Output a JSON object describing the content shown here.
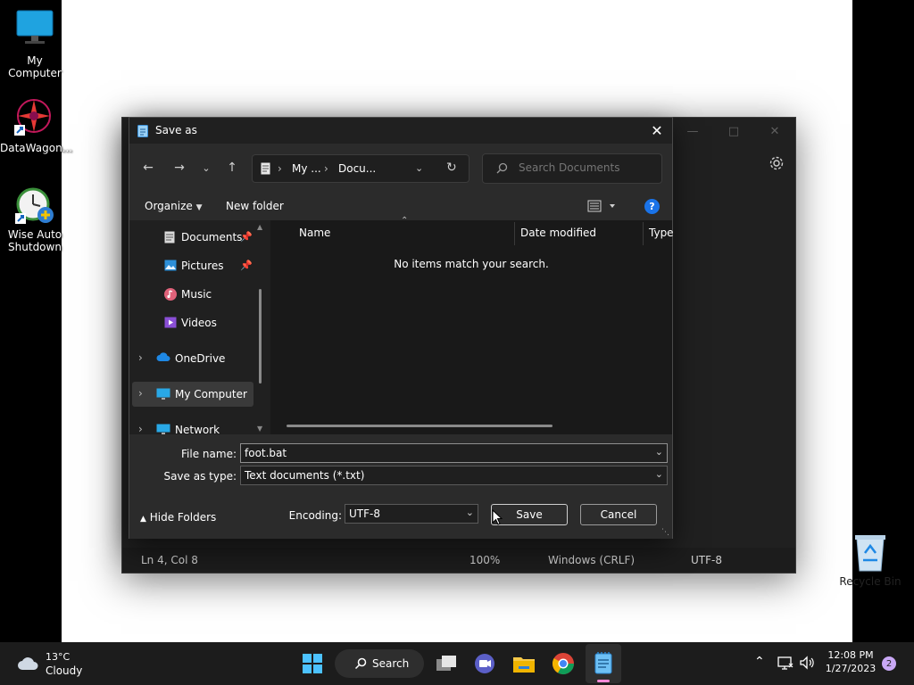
{
  "desktop": {
    "icons": [
      {
        "label": "My Computer"
      },
      {
        "label": "DataWagon..."
      },
      {
        "label": "Wise Auto Shutdown"
      },
      {
        "label": "Recycle Bin"
      }
    ]
  },
  "notepad": {
    "status": {
      "position": "Ln 4, Col 8",
      "zoom": "100%",
      "line_ending": "Windows (CRLF)",
      "encoding": "UTF-8"
    }
  },
  "dialog": {
    "title": "Save as",
    "breadcrumb": [
      "My ...",
      "Docu..."
    ],
    "search_placeholder": "Search Documents",
    "toolbar": {
      "organize": "Organize",
      "new_folder": "New folder",
      "help": "?"
    },
    "nav_items": [
      {
        "label": "Documents"
      },
      {
        "label": "Pictures"
      },
      {
        "label": "Music"
      },
      {
        "label": "Videos"
      },
      {
        "label": "OneDrive"
      },
      {
        "label": "My Computer"
      },
      {
        "label": "Network"
      }
    ],
    "columns": {
      "name": "Name",
      "date_modified": "Date modified",
      "type": "Type"
    },
    "empty_message": "No items match your search.",
    "file_name_label": "File name:",
    "file_name_value": "foot.bat",
    "save_type_label": "Save as type:",
    "save_type_value": "Text documents (*.txt)",
    "encoding_label": "Encoding:",
    "encoding_value": "UTF-8",
    "hide_folders": "Hide Folders",
    "save": "Save",
    "cancel": "Cancel"
  },
  "taskbar": {
    "weather": {
      "temp": "13°C",
      "condition": "Cloudy"
    },
    "search_label": "Search",
    "time": "12:08 PM",
    "date": "1/27/2023",
    "notifications": "2"
  }
}
